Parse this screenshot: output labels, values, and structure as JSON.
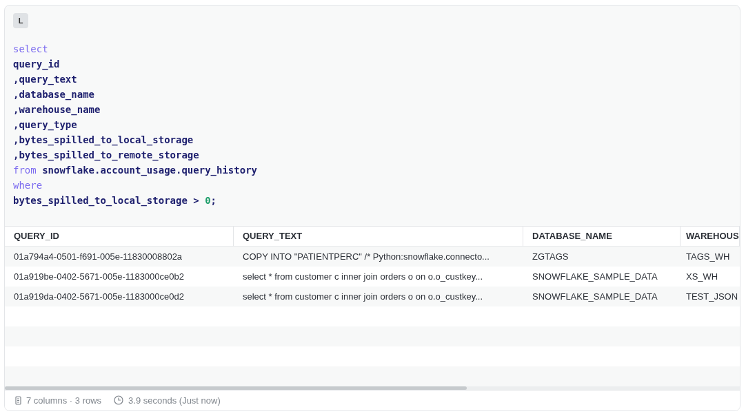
{
  "cell_badge": "L",
  "code": {
    "lines": [
      [
        {
          "kind": "keyword",
          "text": "select"
        }
      ],
      [
        {
          "kind": "ident",
          "text": "query_id"
        }
      ],
      [
        {
          "kind": "ident",
          "text": ",query_text"
        }
      ],
      [
        {
          "kind": "ident",
          "text": ",database_name"
        }
      ],
      [
        {
          "kind": "ident",
          "text": ",warehouse_name"
        }
      ],
      [
        {
          "kind": "ident",
          "text": ",query_type"
        }
      ],
      [
        {
          "kind": "ident",
          "text": ",bytes_spilled_to_local_storage"
        }
      ],
      [
        {
          "kind": "ident",
          "text": ",bytes_spilled_to_remote_storage"
        }
      ],
      [
        {
          "kind": "keyword",
          "text": "from"
        },
        {
          "kind": "ident",
          "text": " snowflake.account_usage.query_history"
        }
      ],
      [
        {
          "kind": "keyword",
          "text": "where"
        }
      ],
      [
        {
          "kind": "ident",
          "text": "bytes_spilled_to_local_storage > "
        },
        {
          "kind": "number",
          "text": "0"
        },
        {
          "kind": "ident",
          "text": ";"
        }
      ]
    ]
  },
  "table": {
    "columns": [
      "QUERY_ID",
      "QUERY_TEXT",
      "DATABASE_NAME",
      "WAREHOUS"
    ],
    "rows": [
      [
        "01a794a4-0501-f691-005e-11830008802a",
        "COPY INTO \"PATIENTPERC\" /* Python:snowflake.connecto...",
        "ZGTAGS",
        "TAGS_WH"
      ],
      [
        "01a919be-0402-5671-005e-1183000ce0b2",
        "select * from customer c inner join orders o on o.o_custkey...",
        "SNOWFLAKE_SAMPLE_DATA",
        "XS_WH"
      ],
      [
        "01a919da-0402-5671-005e-1183000ce0d2",
        "select * from customer c inner join orders o on o.o_custkey...",
        "SNOWFLAKE_SAMPLE_DATA",
        "TEST_JSON"
      ]
    ]
  },
  "status_bar": {
    "shape": "7 columns · 3 rows",
    "duration": "3.9 seconds (Just now)"
  }
}
